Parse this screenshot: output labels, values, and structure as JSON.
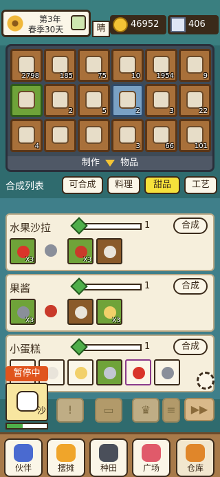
{
  "status": {
    "year": "第3年",
    "season_day": "春季30天",
    "weather": "晴",
    "coins": "46952",
    "gems": "406"
  },
  "inventory": {
    "footer_left": "制作",
    "footer_right": "物品",
    "cells": [
      {
        "count": "2798",
        "bg": "brown"
      },
      {
        "count": "185",
        "bg": "brown"
      },
      {
        "count": "75",
        "bg": "brown"
      },
      {
        "count": "10",
        "bg": "brown"
      },
      {
        "count": "1954",
        "bg": "brown"
      },
      {
        "count": "9",
        "bg": "brown"
      },
      {
        "count": "",
        "bg": "green"
      },
      {
        "count": "2",
        "bg": "brown"
      },
      {
        "count": "5",
        "bg": "brown"
      },
      {
        "count": "2",
        "bg": "blue"
      },
      {
        "count": "3",
        "bg": "brown"
      },
      {
        "count": "22",
        "bg": "brown"
      },
      {
        "count": "4",
        "bg": "brown"
      },
      {
        "count": "",
        "bg": "brown"
      },
      {
        "count": "",
        "bg": "brown"
      },
      {
        "count": "3",
        "bg": "brown"
      },
      {
        "count": "66",
        "bg": "brown"
      },
      {
        "count": "101",
        "bg": "brown"
      }
    ]
  },
  "tabs": {
    "label": "合成列表",
    "items": [
      "可合成",
      "料理",
      "甜品",
      "工艺"
    ],
    "active_index": 2
  },
  "recipes": [
    {
      "name": "水果沙拉",
      "count": "1",
      "button": "合成",
      "ingredients": [
        {
          "bg": "green",
          "sub": "X3"
        },
        {
          "bg": "plain",
          "sub": ""
        },
        {
          "bg": "green",
          "sub": "X3"
        },
        {
          "bg": "brown",
          "sub": ""
        }
      ]
    },
    {
      "name": "果酱",
      "count": "1",
      "button": "合成",
      "ingredients": [
        {
          "bg": "green",
          "sub": "X3"
        },
        {
          "bg": "plain",
          "sub": ""
        },
        {
          "bg": "brown",
          "sub": ""
        },
        {
          "bg": "green",
          "sub": "X3"
        }
      ]
    },
    {
      "name": "小蛋糕",
      "count": "1",
      "button": "合成",
      "ingredients": [
        {
          "bg": "white",
          "sub": ""
        },
        {
          "bg": "white",
          "sub": ""
        },
        {
          "bg": "white",
          "sub": ""
        },
        {
          "bg": "green",
          "sub": ""
        },
        {
          "bg": "purple",
          "sub": ""
        },
        {
          "bg": "white",
          "sub": ""
        }
      ]
    }
  ],
  "paused_badge": "暂停中",
  "partial_recipe_text": "沙",
  "stamina_fraction": 0.4,
  "nav": {
    "items": [
      "伙伴",
      "摆摊",
      "种田",
      "广场",
      "仓库"
    ],
    "active_index": 4
  },
  "colors": {
    "background": "#2f6b6e",
    "active_tab": "#f6e13b",
    "paused": "#e0541d",
    "coin": "#f4c435"
  }
}
